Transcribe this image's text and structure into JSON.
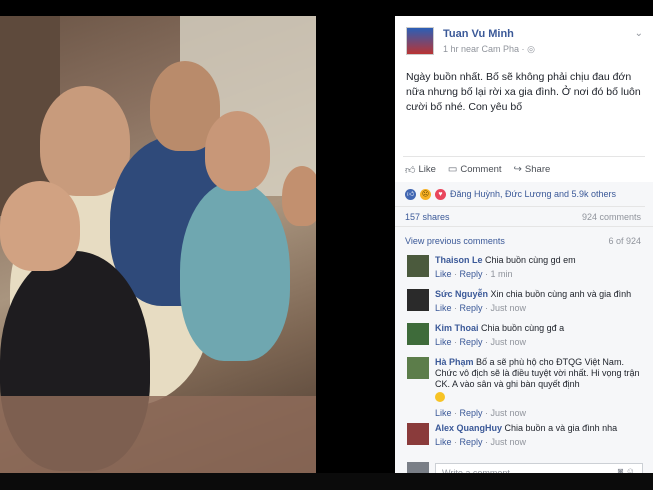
{
  "post": {
    "author": "Tuan Vu Minh",
    "meta": "1 hr near Cam Pha ·",
    "text": "Ngày buồn nhất. Bố sẽ không phải chịu đau đớn nữa nhưng bố lại rời xa gia đình. Ở nơi đó bố luôn cười bố nhé. Con yêu bố"
  },
  "actions": {
    "like": "Like",
    "comment": "Comment",
    "share": "Share"
  },
  "reactions": {
    "text": "Đăng Huỳnh, Đức Lương and 5.9k others"
  },
  "stats": {
    "shares": "157 shares",
    "comments": "924 comments"
  },
  "prev": {
    "label": "View previous comments",
    "count": "6 of 924"
  },
  "comments": [
    {
      "name": "Thaison Le",
      "text": "Chia buồn cùng gd em",
      "like": "Like",
      "reply": "Reply",
      "time": "1 min",
      "avatar_color": "#4b5a3d"
    },
    {
      "name": "Sức Nguyễn",
      "text": "Xin chia buồn cùng anh và gia đình",
      "like": "Like",
      "reply": "Reply",
      "time": "Just now",
      "avatar_color": "#2a2a2a"
    },
    {
      "name": "Kim Thoai",
      "text": "Chia buồn cùng gđ a",
      "like": "Like",
      "reply": "Reply",
      "time": "Just now",
      "avatar_color": "#3e6b3a"
    },
    {
      "name": "Hà Phạm",
      "text": "Bố a sẽ phù hộ cho ĐTQG Việt Nam. Chức vô địch sẽ là điều tuyệt vời nhất. Hi vọng trận CK. A vào sân và ghi bàn quyết định",
      "like": "Like",
      "reply": "Reply",
      "time": "Just now",
      "avatar_color": "#5c7d4a"
    },
    {
      "name": "Alex QuangHuy",
      "text": "Chia buồn a và gia đình nha",
      "like": "Like",
      "reply": "Reply",
      "time": "Just now",
      "avatar_color": "#8a3b3b"
    }
  ],
  "write": {
    "placeholder": "Write a comment..."
  }
}
